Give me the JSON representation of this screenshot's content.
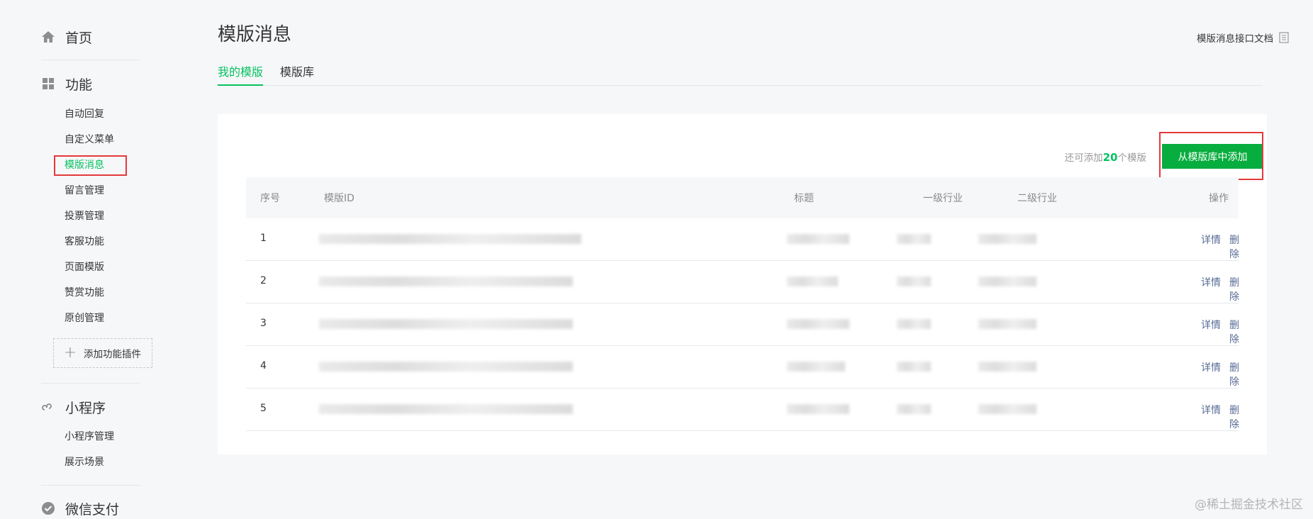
{
  "sidebar": {
    "home": "首页",
    "func_section": "功能",
    "func_items": [
      "自动回复",
      "自定义菜单",
      "模版消息",
      "留言管理",
      "投票管理",
      "客服功能",
      "页面模版",
      "赞赏功能",
      "原创管理"
    ],
    "add_plugin": "添加功能插件",
    "mini_section": "小程序",
    "mini_items": [
      "小程序管理",
      "展示场景"
    ],
    "pay_section": "微信支付"
  },
  "header": {
    "title": "模版消息",
    "doc_link": "模版消息接口文档",
    "tabs": [
      "我的模版",
      "模版库"
    ]
  },
  "panel": {
    "remain_prefix": "还可添加",
    "remain_count": "20",
    "remain_suffix": "个模版",
    "add_button": "从模版库中添加",
    "columns": [
      "序号",
      "模版ID",
      "标题",
      "一级行业",
      "二级行业",
      "操作"
    ],
    "rows": [
      {
        "index": "1",
        "detail": "详情",
        "delete": "删除"
      },
      {
        "index": "2",
        "detail": "详情",
        "delete": "删除"
      },
      {
        "index": "3",
        "detail": "详情",
        "delete": "删除"
      },
      {
        "index": "4",
        "detail": "详情",
        "delete": "删除"
      },
      {
        "index": "5",
        "detail": "详情",
        "delete": "删除"
      }
    ]
  },
  "watermark": "@稀土掘金技术社区",
  "colors": {
    "accent": "#07c160",
    "button": "#07ad3e",
    "link": "#576b95",
    "highlight_box": "#e4393c"
  }
}
